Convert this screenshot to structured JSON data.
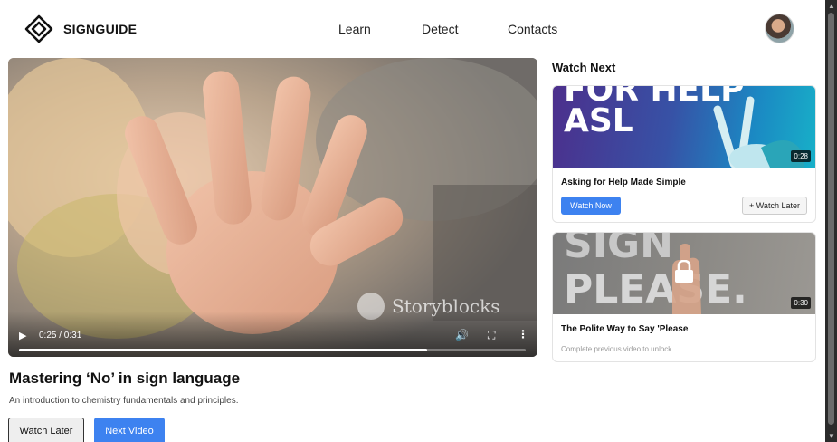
{
  "header": {
    "brand": "SIGNGUIDE",
    "nav": [
      "Learn",
      "Detect",
      "Contacts"
    ]
  },
  "player": {
    "time": "0:25 / 0:31",
    "progress": 0.806,
    "watermark": "Storyblocks",
    "icons": [
      "play-icon",
      "volume-icon",
      "fullscreen-icon",
      "more-options-icon"
    ]
  },
  "video": {
    "title": "Mastering ‘No’ in sign language",
    "description": "An introduction to chemistry fundamentals and principles.",
    "watch_later_label": "Watch Later",
    "next_label": "Next Video"
  },
  "sidebar": {
    "heading": "Watch Next",
    "items": [
      {
        "thumb_line1": "FOR HELP",
        "thumb_line2": "ASL",
        "duration": "0:28",
        "title": "Asking for Help Made Simple",
        "watch_now_label": "Watch Now",
        "watch_later_label": "+ Watch Later"
      },
      {
        "thumb_line1": "SIGN",
        "thumb_line2": "PLEASE.",
        "duration": "0:30",
        "title": "The Polite Way to Say 'Please",
        "note": "Complete previous video to unlock"
      }
    ]
  },
  "colors": {
    "accent": "#3d82f0",
    "scrollbar": "#2b2b2b"
  }
}
